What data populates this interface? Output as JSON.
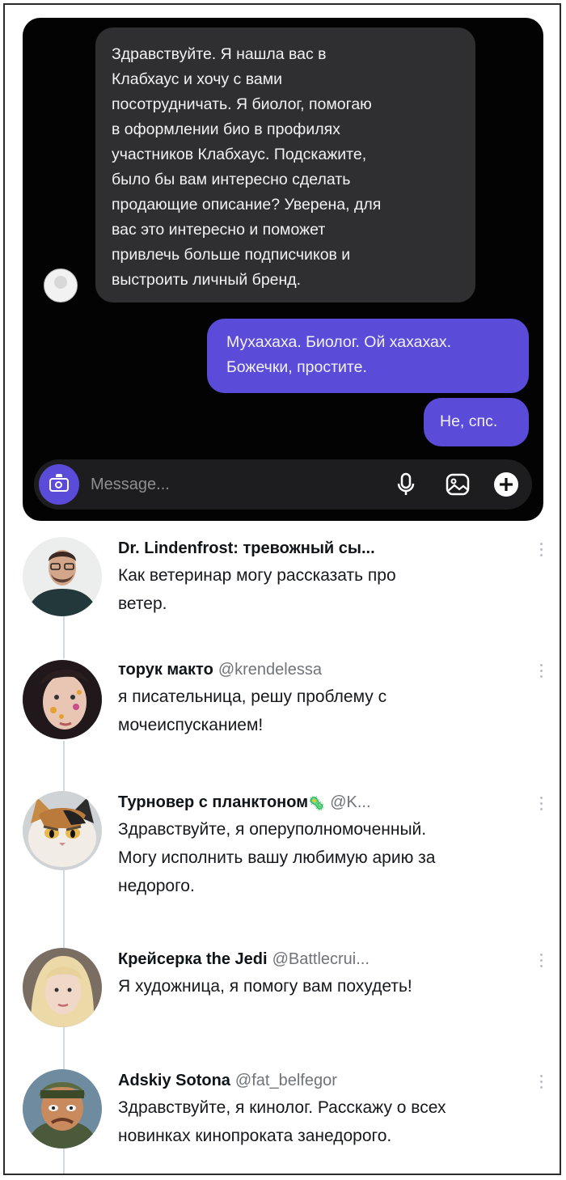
{
  "chat": {
    "incoming_message": "Здравствуйте. Я нашла вас в\nКлабхаус и хочу с вами\nпосотрудничать. Я биолог, помогаю\nв оформлении био в профилях\nучастников Клабхаус. Подскажите,\nбыло бы вам интересно сделать\nпродающие описание? Уверена, для\nвас это интересно и поможет\nпривлечь больше подписчиков и\nвыстроить личный бренд.",
    "outgoing_messages": [
      "Мухахаха. Биолог. Ой хахахах.\nБожечки, простите.",
      "Не, спс."
    ],
    "composer": {
      "placeholder": "Message...",
      "icons": [
        "camera-icon",
        "microphone-icon",
        "gallery-icon",
        "plus-icon"
      ]
    },
    "colors": {
      "background": "#030303",
      "incoming": "#2f2f31",
      "outgoing": "#5b4bd9"
    }
  },
  "tweets": [
    {
      "name": "Dr. Lindenfrost: тревожный сы...",
      "handle": "",
      "text": "Как ветеринар могу рассказать про\nветер."
    },
    {
      "name": "торук макто",
      "handle": "@krendelessa",
      "text": "я писательница, решу проблему с\nмочеиспусканием!"
    },
    {
      "name": "Турновер с планктоном",
      "handle": "@K...",
      "text": "Здравствуйте, я оперуполномоченный.\nМогу исполнить вашу любимую арию за\nнедорого."
    },
    {
      "name": "Крейсерка the Jedi",
      "handle": "@Battlecrui...",
      "text": "Я художница, я помогу вам похудеть!"
    },
    {
      "name": "Adskiy Sotona",
      "handle": "@fat_belfegor",
      "text": "Здравствуйте, я кинолог. Расскажу о всех\nновинках кинопроката занедорого."
    }
  ]
}
